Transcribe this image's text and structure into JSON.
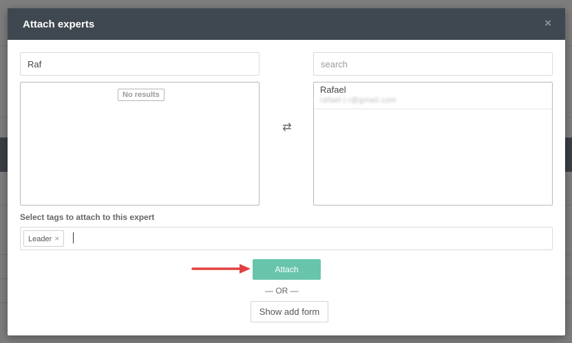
{
  "modal": {
    "title": "Attach experts",
    "close_glyph": "×"
  },
  "left_panel": {
    "search_value": "Raf",
    "no_results_text": "No results"
  },
  "right_panel": {
    "search_placeholder": "search",
    "items": [
      {
        "name": "Rafael",
        "email": "rafael.l.r@gmail.com"
      }
    ]
  },
  "swap_icon": {
    "glyph": "⇄",
    "icon": "swap-arrows-icon"
  },
  "tags": {
    "label": "Select tags to attach to this expert",
    "selected": [
      {
        "label": "Leader",
        "remove_glyph": "×"
      }
    ]
  },
  "actions": {
    "attach_label": "Attach",
    "or_text": "— OR —",
    "show_add_form_label": "Show add form"
  },
  "colors": {
    "header_bg": "#3f4850",
    "attach_button": "#68c5ac",
    "annotation_arrow": "#e04040"
  }
}
